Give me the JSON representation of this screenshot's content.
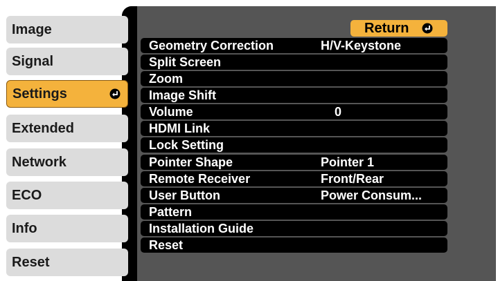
{
  "tabs": [
    {
      "label": "Image"
    },
    {
      "label": "Signal"
    },
    {
      "label": "Settings",
      "active": true
    },
    {
      "label": "Extended"
    },
    {
      "label": "Network"
    },
    {
      "label": "ECO"
    },
    {
      "label": "Info"
    },
    {
      "label": "Reset"
    }
  ],
  "return_label": "Return",
  "icons": {
    "enter": "enter-icon"
  },
  "colors": {
    "accent": "#f4b23c",
    "tab": "#dcdcdc",
    "row": "#000000",
    "backdrop": "#555555"
  },
  "menu": [
    {
      "label": "Geometry Correction",
      "value": "H/V-Keystone"
    },
    {
      "label": "Split Screen",
      "value": ""
    },
    {
      "label": "Zoom",
      "value": ""
    },
    {
      "label": "Image Shift",
      "value": ""
    },
    {
      "label": "Volume",
      "value": "0"
    },
    {
      "label": "HDMI Link",
      "value": ""
    },
    {
      "label": "Lock Setting",
      "value": ""
    },
    {
      "label": "Pointer Shape",
      "value": "Pointer 1"
    },
    {
      "label": "Remote Receiver",
      "value": "Front/Rear"
    },
    {
      "label": "User Button",
      "value": "Power Consum..."
    },
    {
      "label": "Pattern",
      "value": ""
    },
    {
      "label": "Installation Guide",
      "value": ""
    },
    {
      "label": "Reset",
      "value": ""
    }
  ]
}
